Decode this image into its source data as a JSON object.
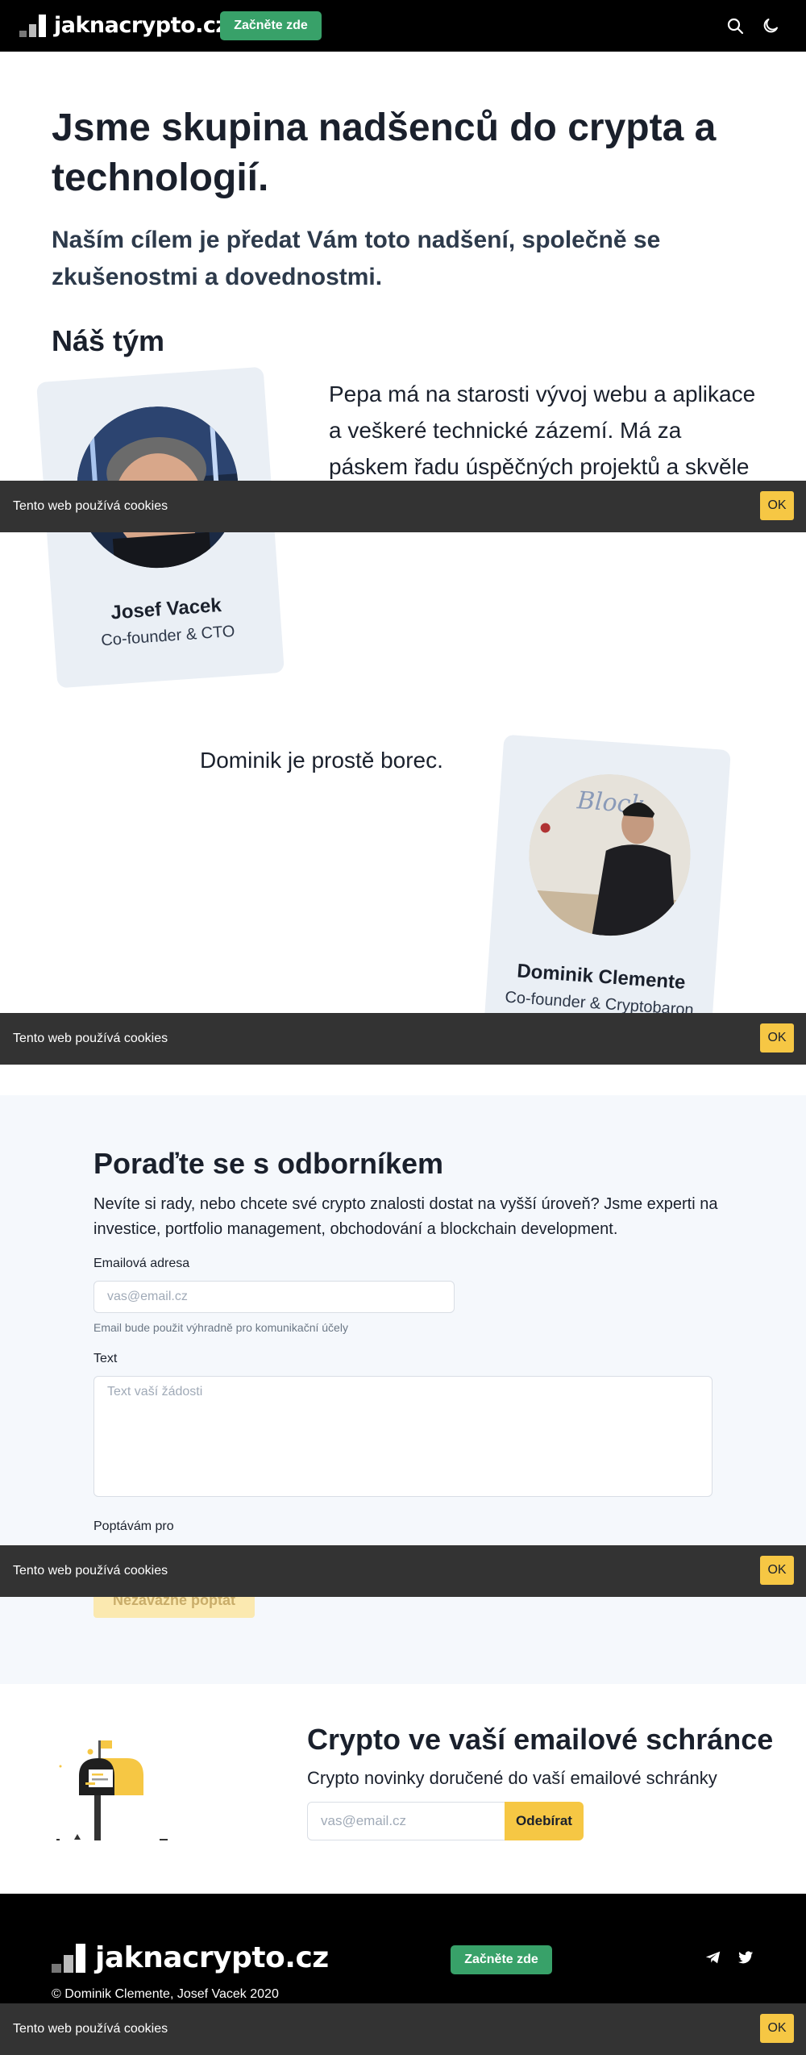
{
  "navbar": {
    "logo_text": "jaknacrypto.cz",
    "cta_label": "Začněte zde",
    "icons": [
      "search-icon",
      "moon-icon"
    ]
  },
  "hero": {
    "title": "Jsme skupina nadšenců do crypta a technologií.",
    "subtitle": "Naším cílem je předat Vám toto nadšení, společně se zkušenostmi a dovednostmi."
  },
  "team": {
    "heading": "Náš tým",
    "members": [
      {
        "name": "Josef Vacek",
        "role": "Co-founder & CTO",
        "bio": "Pepa má na starosti vývoj webu a aplikace a veškeré technické zázemí. Má za páskem řadu úspěčných projektů a skvěle se vyzná i v oblasti marketingu."
      },
      {
        "name": "Dominik Clemente",
        "role": "Co-founder & Cryptobaron",
        "bio": "Dominik je prostě borec."
      }
    ]
  },
  "cookie": {
    "text": "Tento web používá cookies",
    "ok_label": "OK"
  },
  "contact": {
    "title": "Poraďte se s odborníkem",
    "description": "Nevíte si rady, nebo chcete své crypto znalosti dostat na vyšší úroveň? Jsme experti na investice, portfolio management, obchodování a blockchain development.",
    "email_label": "Emailová adresa",
    "email_placeholder": "vas@email.cz",
    "email_helper": "Email bude použit výhradně pro komunikační účely",
    "text_label": "Text",
    "text_placeholder": "Text vaší žádosti",
    "inquiry_label": "Poptávám pro",
    "submit_label": "Nezávazně poptat"
  },
  "newsletter": {
    "title": "Crypto ve vaší emailové schránce",
    "subtitle": "Crypto novinky doručené do vaší emailové schránky",
    "email_placeholder": "vas@email.cz",
    "button_label": "Odebírat"
  },
  "footer": {
    "logo_text": "jaknacrypto.cz",
    "cta_label": "Začněte zde",
    "copyright": "© Dominik Clemente, Josef Vacek 2020",
    "icons": [
      "telegram-icon",
      "twitter-icon"
    ]
  },
  "colors": {
    "accent_green": "#38a169",
    "accent_yellow": "#f6c744",
    "cookie_bar": "#333333"
  }
}
